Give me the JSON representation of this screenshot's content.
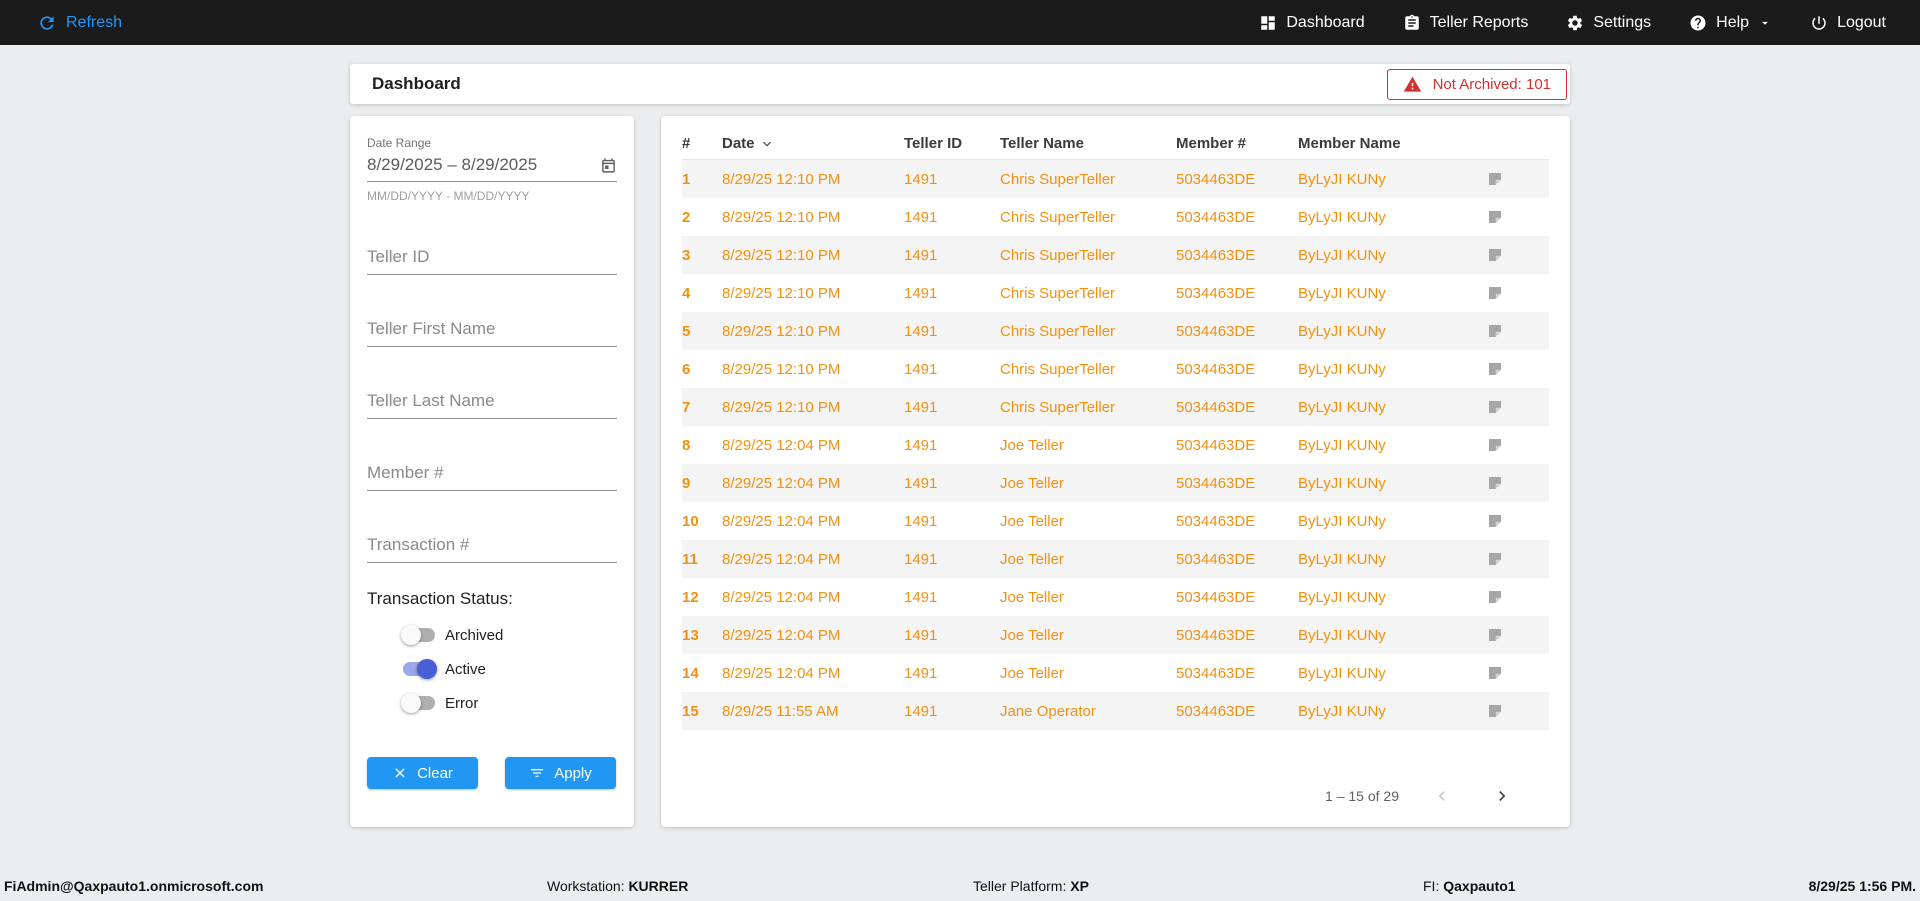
{
  "colors": {
    "accent": "#2196F3",
    "row-text": "#F29111",
    "alert-red": "#d32f2f",
    "toggle-on": "#4a5fd6",
    "toggle-on-track": "#9aa7ea"
  },
  "topbar": {
    "refresh_label": "Refresh",
    "nav": [
      {
        "label": "Dashboard",
        "icon": "dashboard-icon"
      },
      {
        "label": "Teller Reports",
        "icon": "teller-reports-icon"
      },
      {
        "label": "Settings",
        "icon": "settings-icon"
      },
      {
        "label": "Help",
        "icon": "help-icon",
        "has_dropdown": true
      },
      {
        "label": "Logout",
        "icon": "logout-icon"
      }
    ]
  },
  "header": {
    "title": "Dashboard",
    "alert_label": "Not Archived: 101"
  },
  "filters": {
    "date_range": {
      "label": "Date Range",
      "value": "8/29/2025 – 8/29/2025",
      "hint": "MM/DD/YYYY - MM/DD/YYYY"
    },
    "fields": [
      {
        "placeholder": "Teller ID"
      },
      {
        "placeholder": "Teller First Name"
      },
      {
        "placeholder": "Teller Last Name"
      },
      {
        "placeholder": "Member #"
      },
      {
        "placeholder": "Transaction #"
      }
    ],
    "status": {
      "label": "Transaction Status:",
      "toggles": [
        {
          "label": "Archived",
          "on": false
        },
        {
          "label": "Active",
          "on": true
        },
        {
          "label": "Error",
          "on": false
        }
      ]
    },
    "clear_label": "Clear",
    "apply_label": "Apply"
  },
  "table": {
    "columns": [
      "#",
      "Date",
      "Teller ID",
      "Teller Name",
      "Member #",
      "Member Name"
    ],
    "rows": [
      {
        "num": "1",
        "date": "8/29/25 12:10 PM",
        "teller_id": "1491",
        "teller_name": "Chris SuperTeller",
        "member_num": "5034463DE",
        "member_name": "ByLyJI KUNy"
      },
      {
        "num": "2",
        "date": "8/29/25 12:10 PM",
        "teller_id": "1491",
        "teller_name": "Chris SuperTeller",
        "member_num": "5034463DE",
        "member_name": "ByLyJI KUNy"
      },
      {
        "num": "3",
        "date": "8/29/25 12:10 PM",
        "teller_id": "1491",
        "teller_name": "Chris SuperTeller",
        "member_num": "5034463DE",
        "member_name": "ByLyJI KUNy"
      },
      {
        "num": "4",
        "date": "8/29/25 12:10 PM",
        "teller_id": "1491",
        "teller_name": "Chris SuperTeller",
        "member_num": "5034463DE",
        "member_name": "ByLyJI KUNy"
      },
      {
        "num": "5",
        "date": "8/29/25 12:10 PM",
        "teller_id": "1491",
        "teller_name": "Chris SuperTeller",
        "member_num": "5034463DE",
        "member_name": "ByLyJI KUNy"
      },
      {
        "num": "6",
        "date": "8/29/25 12:10 PM",
        "teller_id": "1491",
        "teller_name": "Chris SuperTeller",
        "member_num": "5034463DE",
        "member_name": "ByLyJI KUNy"
      },
      {
        "num": "7",
        "date": "8/29/25 12:10 PM",
        "teller_id": "1491",
        "teller_name": "Chris SuperTeller",
        "member_num": "5034463DE",
        "member_name": "ByLyJI KUNy"
      },
      {
        "num": "8",
        "date": "8/29/25 12:04 PM",
        "teller_id": "1491",
        "teller_name": "Joe Teller",
        "member_num": "5034463DE",
        "member_name": "ByLyJI KUNy"
      },
      {
        "num": "9",
        "date": "8/29/25 12:04 PM",
        "teller_id": "1491",
        "teller_name": "Joe Teller",
        "member_num": "5034463DE",
        "member_name": "ByLyJI KUNy"
      },
      {
        "num": "10",
        "date": "8/29/25 12:04 PM",
        "teller_id": "1491",
        "teller_name": "Joe Teller",
        "member_num": "5034463DE",
        "member_name": "ByLyJI KUNy"
      },
      {
        "num": "11",
        "date": "8/29/25 12:04 PM",
        "teller_id": "1491",
        "teller_name": "Joe Teller",
        "member_num": "5034463DE",
        "member_name": "ByLyJI KUNy"
      },
      {
        "num": "12",
        "date": "8/29/25 12:04 PM",
        "teller_id": "1491",
        "teller_name": "Joe Teller",
        "member_num": "5034463DE",
        "member_name": "ByLyJI KUNy"
      },
      {
        "num": "13",
        "date": "8/29/25 12:04 PM",
        "teller_id": "1491",
        "teller_name": "Joe Teller",
        "member_num": "5034463DE",
        "member_name": "ByLyJI KUNy"
      },
      {
        "num": "14",
        "date": "8/29/25 12:04 PM",
        "teller_id": "1491",
        "teller_name": "Joe Teller",
        "member_num": "5034463DE",
        "member_name": "ByLyJI KUNy"
      },
      {
        "num": "15",
        "date": "8/29/25 11:55 AM",
        "teller_id": "1491",
        "teller_name": "Jane Operator",
        "member_num": "5034463DE",
        "member_name": "ByLyJI KUNy"
      }
    ],
    "pagination": {
      "range": "1 – 15 of 29"
    }
  },
  "footer": {
    "email": "FiAdmin@Qaxpauto1.onmicrosoft.com",
    "workstation_label": "Workstation:",
    "workstation": "KURRER",
    "platform_label": "Teller Platform:",
    "platform": "XP",
    "fi_label": "FI:",
    "fi": "Qaxpauto1",
    "timestamp": "8/29/25 1:56 PM."
  }
}
